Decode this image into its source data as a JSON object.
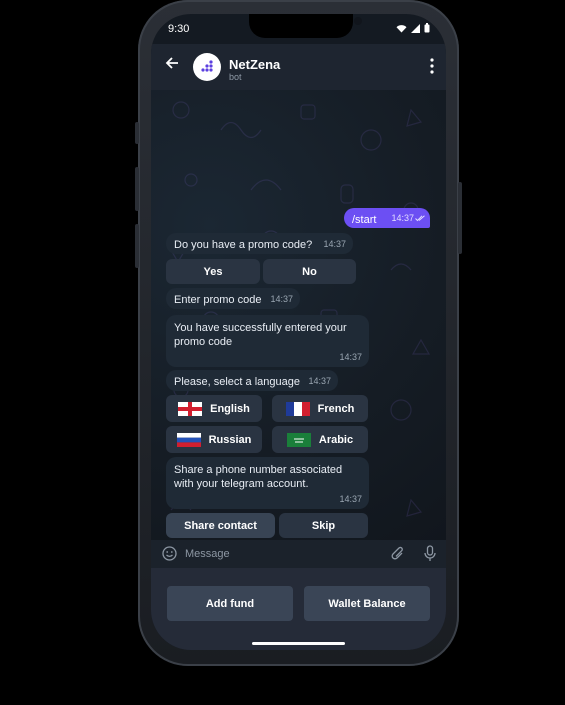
{
  "status": {
    "time": "9:30"
  },
  "header": {
    "name": "NetZena",
    "subtitle": "bot"
  },
  "messages": {
    "start": {
      "text": "/start",
      "time": "14:37"
    },
    "promo_question": {
      "text": "Do you have a promo code?",
      "time": "14:37"
    },
    "enter_promo": {
      "text": "Enter promo code",
      "time": "14:37"
    },
    "promo_success": {
      "text": "You have successfully entered your promo code",
      "time": "14:37"
    },
    "select_language": {
      "text": "Please, select a language",
      "time": "14:37"
    },
    "share_phone": {
      "text": "Share a phone number associated with your telegram account.",
      "time": "14:37"
    }
  },
  "inline_buttons": {
    "yes": "Yes",
    "no": "No",
    "english": "English",
    "french": "French",
    "russian": "Russian",
    "arabic": "Arabic",
    "share_contact": "Share contact",
    "skip": "Skip"
  },
  "input": {
    "placeholder": "Message"
  },
  "keyboard": {
    "add_fund": "Add fund",
    "wallet_balance": "Wallet Balance"
  },
  "colors": {
    "accent": "#6c4ff3",
    "bubble": "#1f2a36",
    "header": "#1e2530"
  }
}
